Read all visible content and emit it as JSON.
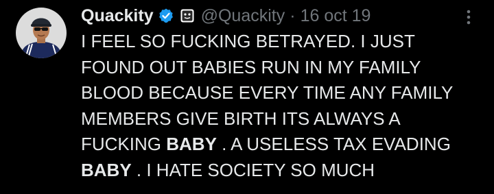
{
  "author": {
    "display_name": "Quackity",
    "handle": "@Quackity",
    "date": "16 oct 19"
  },
  "separator": "·",
  "icons": {
    "verified": "verified-badge-icon",
    "affiliate": "affiliate-badge-icon",
    "more": "more-options-icon",
    "avatar": "profile-avatar"
  },
  "colors": {
    "background": "#000000",
    "text": "#e7e9ea",
    "secondary": "#71767b",
    "verified_blue": "#1d9bf0"
  },
  "tweet": {
    "lines": [
      "I FEEL SO FUCKING BETRAYED. I JUST",
      "FOUND OUT BABIES RUN IN MY FAMILY",
      "BLOOD BECAUSE EVERY TIME ANY FAMILY",
      "MEMBERS GIVE BIRTH ITS ALWAYS A"
    ],
    "line5_a": "FUCKING ",
    "line5_bold": "BABY",
    "line5_b": " . A USELESS TAX EVADING",
    "line6_bold": "BABY",
    "line6_b": " . I HATE SOCIETY SO MUCH"
  }
}
